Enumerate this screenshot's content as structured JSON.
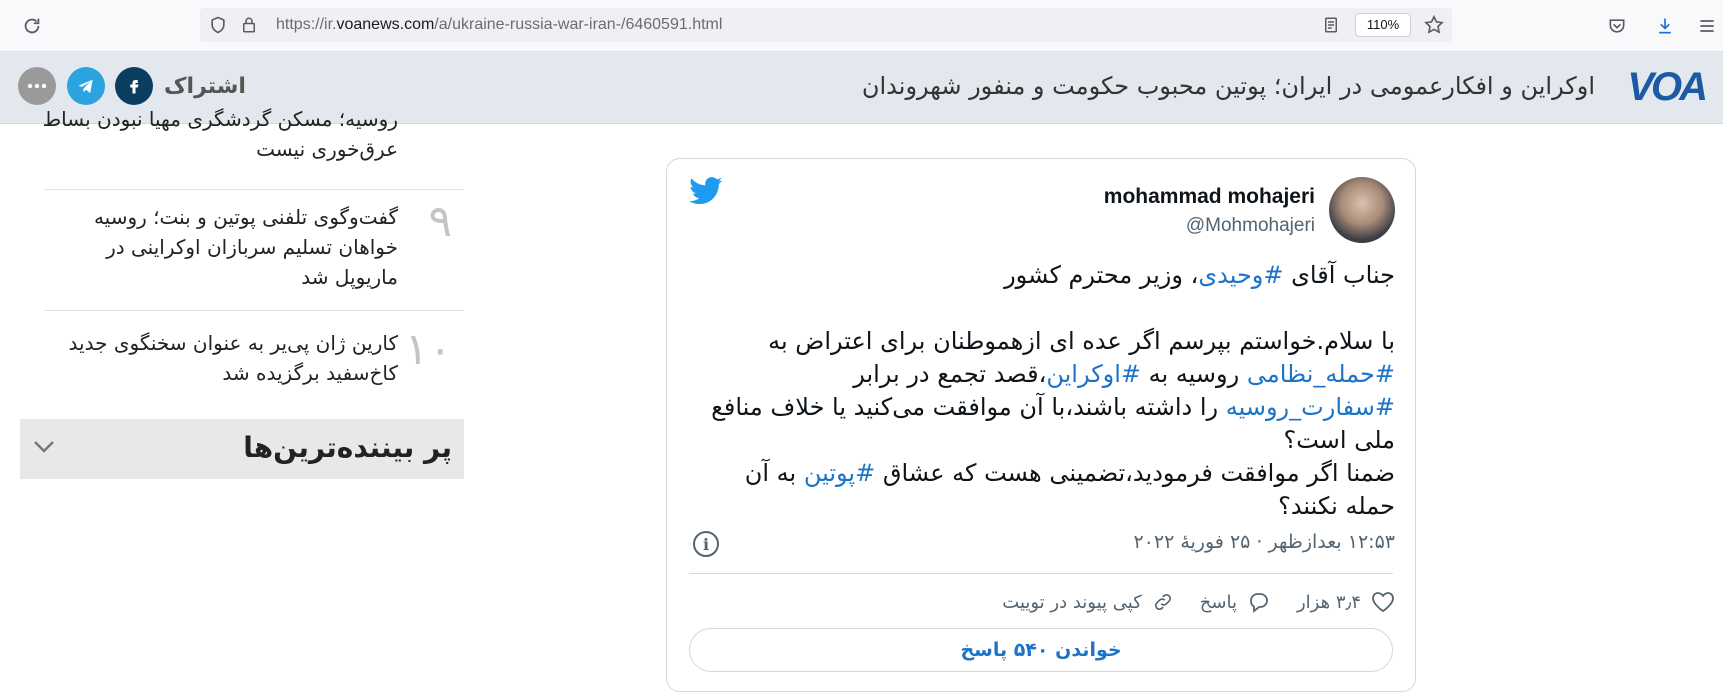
{
  "browser": {
    "url_prefix": "https://ir.",
    "url_host": "voanews.com",
    "url_path": "/a/ukraine-russia-war-iran-/6460591.html",
    "zoom": "110%"
  },
  "header": {
    "logo": "VOA",
    "title": "اوکراین و افکارعمومی در ایران؛ پوتین محبوب حکومت و منفور شهروندان",
    "share_label": "اشتراک"
  },
  "sidebar": {
    "items": [
      {
        "number": "",
        "text": "روسیه؛ مسکن گردشگری مهیا نبودن بساط عرق‌خوری نیست"
      },
      {
        "number": "۹",
        "text": "گفت‌وگوی تلفنی پوتین و بنت؛ روسیه خواهان تسلیم سربازان اوکراینی در ماریوپل شد"
      },
      {
        "number": "۱۰",
        "text": "کارین ژان پی‌یر به عنوان سخنگوی جدید کاخ‌سفید برگزیده شد"
      }
    ],
    "popular_label": "پر بیننده‌ترین‌ها"
  },
  "tweet": {
    "author_name": "mohammad mohajeri",
    "author_handle": "@Mohmohajeri",
    "line1_a": "جناب آقای ",
    "line1_tag": "#وحیدی",
    "line1_b": "، وزیر محترم کشور",
    "p2_a": "با سلام.خواستم بپرسم اگر عده ای ازهموطنان برای اعتراض به ",
    "p2_tag1": "#حمله_نظامی",
    "p2_b": " روسیه به ",
    "p2_tag2": "#اوکراین",
    "p2_c": "،قصد تجمع در برابر ",
    "p2_tag3": "#سفارت_روسیه",
    "p2_d": " را داشته باشند،با آن موافقت می‌کنید یا خلاف منافع ملی است؟",
    "p3_a": "ضمنا اگر موافقت فرمودید،تضمینی هست که عشاق ",
    "p3_tag": "#پوتین",
    "p3_b": " به آن حمله نکنند؟",
    "timestamp": "۱۲:۵۳ بعدازظهر · ۲۵ فوریهٔ ۲۰۲۲",
    "likes": "۳٫۴ هزار",
    "reply_label": "پاسخ",
    "copy_link_label": "کپی پیوند در توییت",
    "read_replies": "خواندن ۵۴۰ پاسخ"
  },
  "colors": {
    "voa_blue": "#1c5ba3",
    "twitter_blue": "#1d9bf0",
    "hashtag": "#1d74c7",
    "facebook": "#1877f2",
    "telegram": "#2aa3df"
  }
}
